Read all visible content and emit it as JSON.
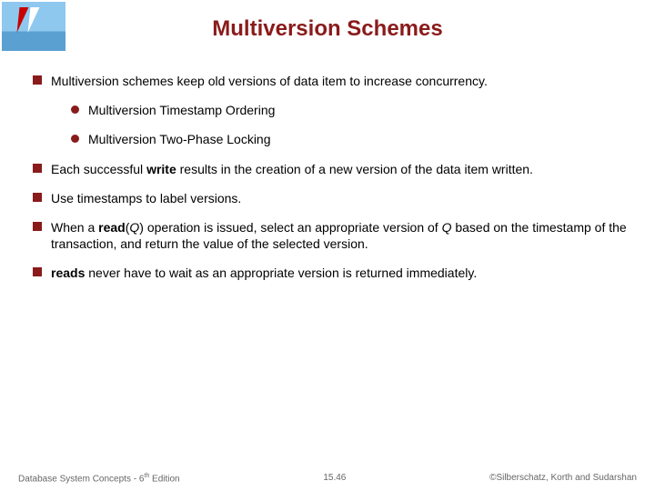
{
  "title": "Multiversion Schemes",
  "bullets": {
    "b1": "Multiversion schemes keep old versions of data item to increase concurrency.",
    "s1": "Multiversion Timestamp Ordering",
    "s2": "Multiversion Two-Phase Locking",
    "b2a": "Each successful ",
    "b2b": "write",
    "b2c": " results in the creation of a new version of the data item written.",
    "b3": "Use timestamps to label versions.",
    "b4a": "When a ",
    "b4b": "read",
    "b4c": "(",
    "b4d": "Q",
    "b4e": ") operation is issued, select an appropriate version of ",
    "b4f": "Q",
    "b4g": " based on the timestamp of the transaction, and return the value of the selected version.",
    "b5a": "reads",
    "b5b": " never have to wait as an appropriate version is returned immediately."
  },
  "footer": {
    "left_a": "Database System Concepts - 6",
    "left_sup": "th",
    "left_b": " Edition",
    "center": "15.46",
    "right": "©Silberschatz, Korth and Sudarshan"
  }
}
